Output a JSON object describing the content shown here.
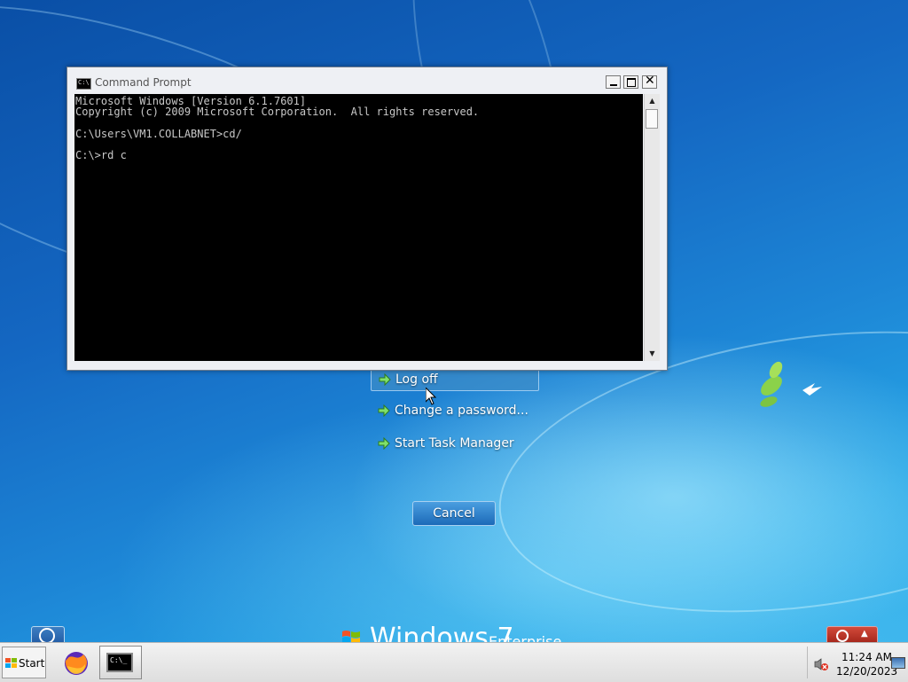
{
  "cmd_window": {
    "title": "Command Prompt",
    "icon_glyph": "C:\\",
    "console_lines": [
      "Microsoft Windows [Version 6.1.7601]",
      "Copyright (c) 2009 Microsoft Corporation.  All rights reserved.",
      "",
      "C:\\Users\\VM1.COLLABNET>cd/",
      "",
      "C:\\>rd c"
    ]
  },
  "security_options": {
    "log_off": "Log off",
    "change_password": "Change a password...",
    "task_manager": "Start Task Manager",
    "cancel": "Cancel"
  },
  "branding": {
    "name": "Windows 7",
    "edition": "Enterprise"
  },
  "taskbar": {
    "start_label": "Start",
    "cmd_icon_glyph": "C:\\_",
    "clock_time": "11:24 AM",
    "clock_date": "12/20/2023"
  },
  "colors": {
    "console_bg": "#000000",
    "console_text": "#c8c8c8",
    "desktop_blue": "#1467c2"
  }
}
